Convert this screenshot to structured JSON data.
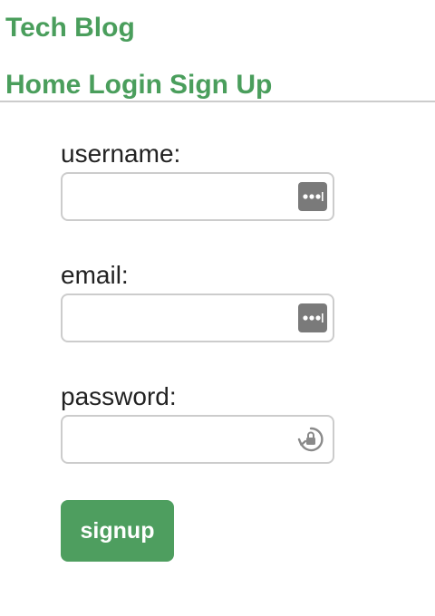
{
  "header": {
    "brand": "Tech Blog",
    "nav": [
      {
        "label": "Home"
      },
      {
        "label": "Login"
      },
      {
        "label": "Sign Up"
      }
    ]
  },
  "form": {
    "username": {
      "label": "username:",
      "value": "",
      "placeholder": ""
    },
    "email": {
      "label": "email:",
      "value": "",
      "placeholder": ""
    },
    "password": {
      "label": "password:",
      "value": "",
      "placeholder": ""
    },
    "submit_label": "signup"
  },
  "icons": {
    "autofill": "password-manager-dots-icon",
    "lock": "lock-cycle-icon"
  },
  "colors": {
    "accent": "#4a9e5c",
    "button": "#4e9e5f",
    "divider": "#cccccc"
  }
}
